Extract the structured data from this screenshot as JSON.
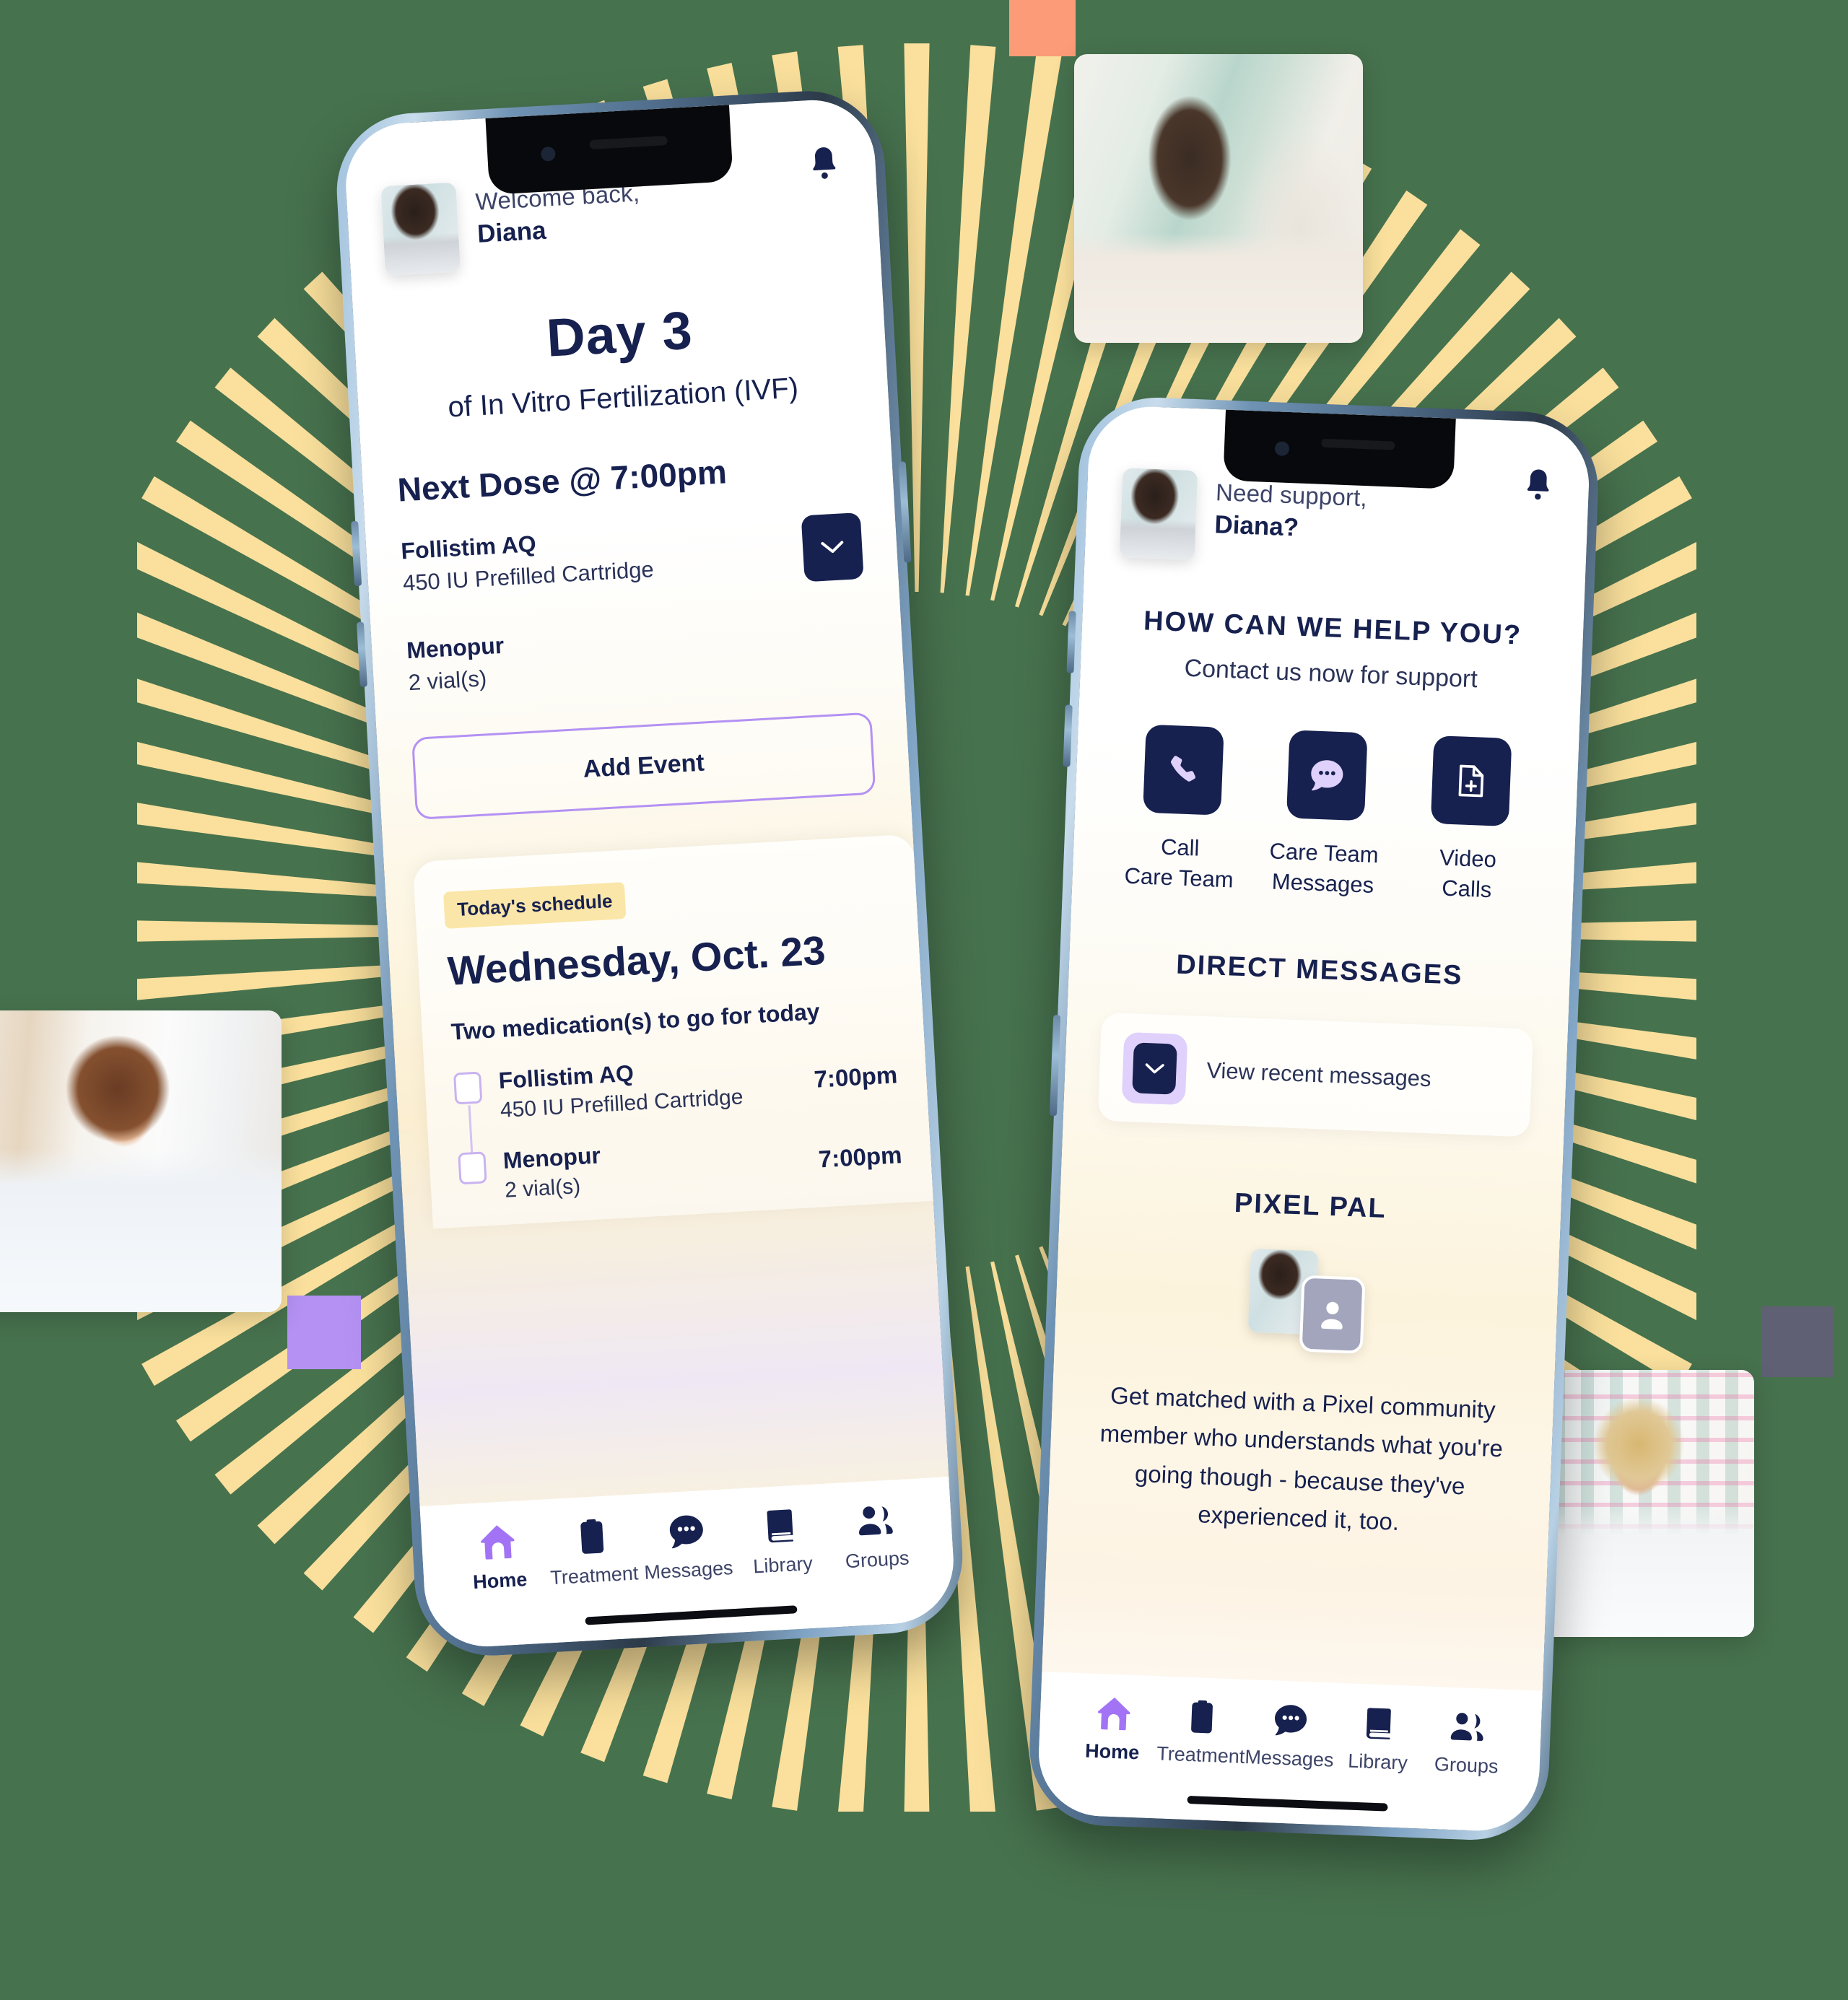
{
  "background": {
    "canvas_color": "#47724e",
    "ray_color": "#fae09c",
    "squares": [
      {
        "name": "orange-square",
        "color": "#fb9b77"
      },
      {
        "name": "purple-square",
        "color": "#b491f3"
      },
      {
        "name": "gray-square",
        "color": "#5f6074"
      }
    ],
    "photos": [
      {
        "name": "woman-reading-photo",
        "alt": "Woman reading a book on a sofa"
      },
      {
        "name": "doctor-tablet-photo",
        "alt": "Doctor with stethoscope reading a tablet"
      },
      {
        "name": "pharmacist-photo",
        "alt": "Pharmacist at a pharmacy shelf"
      }
    ]
  },
  "phone_home": {
    "header": {
      "greeting": "Welcome back,",
      "user_name": "Diana",
      "avatar_alt": "Diana profile photo",
      "bell_icon": "bell-icon"
    },
    "day_title": "Day 3",
    "day_subtitle": "of In Vitro Fertilization (IVF)",
    "next_dose_title": "Next Dose @ 7:00pm",
    "medications": [
      {
        "name": "Follistim AQ",
        "dose": "450 IU Prefilled Cartridge"
      },
      {
        "name": "Menopur",
        "dose": "2 vial(s)"
      }
    ],
    "expand_icon": "chevron-down-icon",
    "add_event_label": "Add Event",
    "schedule": {
      "badge": "Today's schedule",
      "date": "Wednesday, Oct. 23",
      "note": "Two medication(s) to go for today",
      "tasks": [
        {
          "name": "Follistim AQ",
          "sub": "450 IU Prefilled Cartridge",
          "time": "7:00pm",
          "checked": false
        },
        {
          "name": "Menopur",
          "sub": "2 vial(s)",
          "time": "7:00pm",
          "checked": false
        }
      ]
    },
    "tabs": [
      {
        "label": "Home",
        "icon": "home-icon",
        "active": true
      },
      {
        "label": "Treatment",
        "icon": "clipboard-icon",
        "active": false
      },
      {
        "label": "Messages",
        "icon": "chat-bubble-icon",
        "active": false
      },
      {
        "label": "Library",
        "icon": "book-icon",
        "active": false
      },
      {
        "label": "Groups",
        "icon": "people-icon",
        "active": false
      }
    ]
  },
  "phone_support": {
    "header": {
      "greeting": "Need support,",
      "user_name": "Diana?",
      "avatar_alt": "Diana profile photo",
      "bell_icon": "bell-icon"
    },
    "help_title": "HOW CAN WE HELP YOU?",
    "help_subtitle": "Contact us now for support",
    "actions": [
      {
        "label": "Call\nCare Team",
        "icon": "phone-icon"
      },
      {
        "label": "Care Team\nMessages",
        "icon": "chat-bubble-icon"
      },
      {
        "label": "Video\nCalls",
        "icon": "video-file-icon"
      }
    ],
    "direct_messages": {
      "title": "DIRECT MESSAGES",
      "row_label": "View recent messages",
      "row_icon": "chevron-down-icon"
    },
    "pixel_pal": {
      "title": "PIXEL PAL",
      "avatar_alt": "Pixel Pal member photo",
      "badge_icon": "person-icon",
      "description": "Get matched with a Pixel community member who understands what you're going though - because they've experienced it, too."
    },
    "tabs": [
      {
        "label": "Home",
        "icon": "home-icon",
        "active": true
      },
      {
        "label": "Treatment",
        "icon": "clipboard-icon",
        "active": false
      },
      {
        "label": "Messages",
        "icon": "chat-bubble-icon",
        "active": false
      },
      {
        "label": "Library",
        "icon": "book-icon",
        "active": false
      },
      {
        "label": "Groups",
        "icon": "people-icon",
        "active": false
      }
    ]
  },
  "colors": {
    "navy": "#17214f",
    "purple": "#b491f3",
    "yellow_badge": "#fae6a8",
    "lavender": "#dfd1fb"
  }
}
